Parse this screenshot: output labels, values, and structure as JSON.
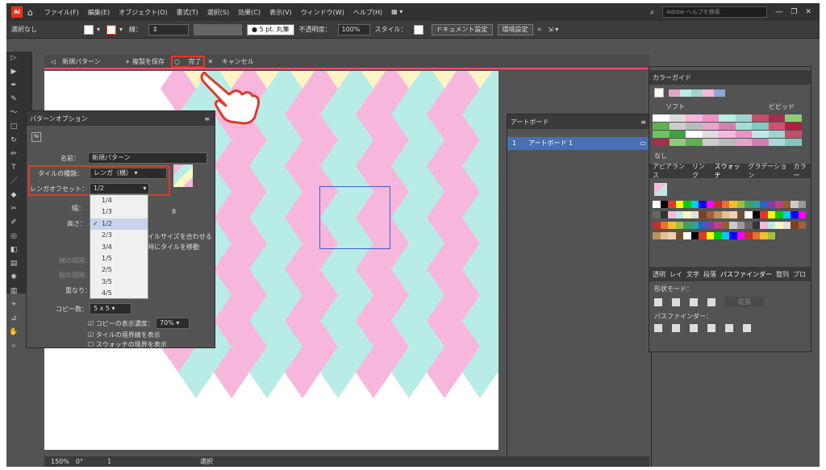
{
  "menubar": {
    "logo": "Ai",
    "menus": [
      "ファイル(F)",
      "編集(E)",
      "オブジェクト(O)",
      "書式(T)",
      "選択(S)",
      "効果(C)",
      "表示(V)",
      "ウィンドウ(W)",
      "ヘルプ(H)"
    ],
    "search_placeholder": "Adobe ヘルプを検索"
  },
  "controlbar": {
    "selection": "選択なし",
    "stroke_label": "線：",
    "brush": "5 pt. 丸筆",
    "opacity_label": "不透明度：",
    "opacity_value": "100%",
    "style_label": "スタイル：",
    "doc_settings": "ドキュメント設定",
    "prefs": "環境設定"
  },
  "docbar": {
    "title": "新規パターン",
    "save_copy": "+ 複製を保存",
    "done": "完了",
    "cancel": "キャンセル"
  },
  "pattern_options": {
    "tab": "パターンオプション",
    "name_label": "名前：",
    "name_value": "新規パターン",
    "tile_type_label": "タイルの種類：",
    "tile_type_value": "レンガ（横）",
    "brick_offset_label": "レンガオフセット：",
    "brick_offset_value": "1/2",
    "width_label": "幅：",
    "height_label": "高さ：",
    "fit_text": "イルサイズを合わせる",
    "move_text": "時にタイルを移動",
    "h_spacing_label": "横の間隔：",
    "v_spacing_label": "縦の間隔：",
    "overlap_label": "重なり：",
    "copies_label": "コピー数：",
    "copies_value": "5 x 5",
    "dim_copies_label": "コピーの表示濃度：",
    "dim_value": "70%",
    "show_tile_edge": "タイルの境界線を表示",
    "show_swatch_bounds": "スウォッチの境界を表示"
  },
  "dropdown": {
    "items": [
      "1/4",
      "1/3",
      "1/2",
      "2/3",
      "3/4",
      "1/5",
      "2/5",
      "3/5",
      "4/5"
    ],
    "selected": "1/2"
  },
  "artboards": {
    "tab": "アートボード",
    "rows": [
      {
        "num": "1",
        "name": "アートボード 1"
      }
    ]
  },
  "right_panels": {
    "color_guide": "カラーガイド",
    "soft": "ソフト",
    "vivid": "ビビッド",
    "none": "なし",
    "tabs": [
      "アピアランス",
      "リンク",
      "スウォッチ",
      "グラデーション",
      "カラー"
    ],
    "pathfinder_tabs": [
      "透明",
      "レイ",
      "文字",
      "段落",
      "パスファインダー",
      "整列",
      "プロ"
    ],
    "shape_mode": "形状モード：",
    "pathfinder": "パスファインダー：",
    "expand": "拡張"
  },
  "bottombar": {
    "zoom": "150%",
    "rotate": "0°",
    "page": "1",
    "mode": "選択"
  },
  "colors": {
    "pink": "#f7b6dc",
    "cyan": "#b8ece6",
    "yellow": "#fff5c4",
    "accent_red": "#e0392b",
    "selection_blue": "#4a6fb3"
  }
}
